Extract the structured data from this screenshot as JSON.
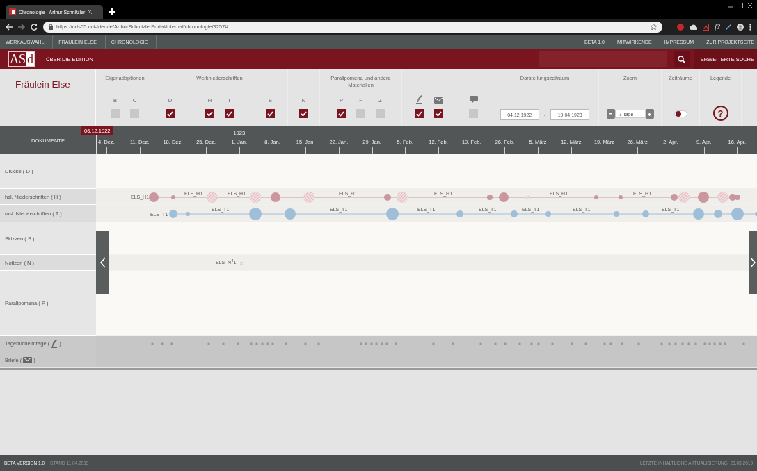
{
  "browser": {
    "tab_title": "Chronologie - Arthur Schnitzler",
    "url": "https://urts55.uni-trier.de/ArthurSchnitzlerPortal/internal/chronologie/9257#",
    "extension_label": "f?"
  },
  "site_nav": {
    "breadcrumbs": [
      "WERKAUSWAHL",
      "FRÄULEIN ELSE",
      "CHRONOLOGIE"
    ],
    "links": [
      "BETA 1.0",
      "MITWIRKENDE",
      "IMPRESSUM",
      "ZUR PROJEKTSEITE"
    ]
  },
  "header": {
    "logo": {
      "main": "AS",
      "accent": "d"
    },
    "menu": [
      "ÜBER DIE EDITION"
    ],
    "advanced_search": "ERWEITERTE SUCHE"
  },
  "filters": {
    "title": "Fräulein Else",
    "groups": [
      {
        "kind": "checks",
        "heading": "Eigenadaptionen",
        "options": [
          {
            "label": "B",
            "checked": false
          },
          {
            "label": "C",
            "checked": false
          }
        ]
      },
      {
        "kind": "checks",
        "options": [
          {
            "label": "D",
            "checked": true
          }
        ]
      },
      {
        "kind": "checks",
        "heading": "Werkniederschriften",
        "options": [
          {
            "label": "H",
            "checked": true
          },
          {
            "label": "T",
            "checked": true
          }
        ]
      },
      {
        "kind": "checks",
        "options": [
          {
            "label": "S",
            "checked": true
          }
        ]
      },
      {
        "kind": "checks",
        "options": [
          {
            "label": "N",
            "checked": true
          }
        ]
      },
      {
        "kind": "checks",
        "heading": "Paralipomena und andere Materialien",
        "options": [
          {
            "label": "P",
            "checked": true
          },
          {
            "label": "F",
            "checked": false
          },
          {
            "label": "Z",
            "checked": false
          }
        ]
      },
      {
        "kind": "checks",
        "options": [
          {
            "kind": "diary",
            "checked": true
          },
          {
            "kind": "correspondence",
            "checked": true
          }
        ]
      },
      {
        "kind": "checks",
        "options": [
          {
            "kind": "comment",
            "checked": false
          }
        ]
      },
      {
        "kind": "daterange",
        "heading": "Darstellungszeitraum",
        "from": "04.12.1922",
        "separator": "-",
        "to": "19.04.1923"
      },
      {
        "kind": "stepper",
        "heading": "Zoom",
        "value": "7 Tage"
      },
      {
        "kind": "toggle",
        "heading": "Zeiträume",
        "on": false
      },
      {
        "kind": "help",
        "heading": "Legende",
        "symbol": "?"
      }
    ]
  },
  "timeline": {
    "column_label": "DOKUMENTE",
    "marker_date": "06.12.1922",
    "year_label": "1923",
    "ticks": [
      "4. Dez.",
      "11. Dez.",
      "18. Dez.",
      "25. Dez.",
      "1. Jan.",
      "8. Jan.",
      "15. Jan.",
      "22. Jan.",
      "29. Jan.",
      "5. Feb.",
      "12. Feb.",
      "19. Feb.",
      "26. Feb.",
      "5. März",
      "12. März",
      "19. März",
      "26. März",
      "2. Apr.",
      "9. Apr.",
      "16. Apr."
    ],
    "rows": [
      {
        "kind": "empty",
        "label": "Drucke ( D )"
      },
      {
        "kind": "manuscript",
        "label": "hsl. Niederschriften ( H )",
        "entry_labels": [
          "ELS_H1",
          "ELS_H1",
          "ELS_H1",
          "ELS_H1",
          "ELS_H1",
          "ELS_H1",
          "ELS_H1"
        ]
      },
      {
        "kind": "typescript",
        "label": "msl. Niederschriften ( T )",
        "entry_labels": [
          "ELS_T1",
          "ELS_T1",
          "ELS_T1",
          "ELS_T1",
          "ELS_T1",
          "ELS_T1",
          "ELS_T1",
          "ELS_T1"
        ]
      },
      {
        "kind": "empty",
        "label": "Skizzen ( S )"
      },
      {
        "kind": "notes",
        "label": "Notizen ( N )",
        "entry_labels": [
          "ELS_N$^{4}$1"
        ]
      },
      {
        "kind": "empty",
        "label": "Paralipomena ( P )"
      },
      {
        "kind": "diary",
        "label_start": "Tagebucheinträge (",
        "label_end": ")"
      },
      {
        "kind": "letters",
        "label_start": "Briefe (",
        "label_end": ")"
      }
    ]
  },
  "footer": {
    "version": "BETA VERSION 1.0",
    "stand": "STAND 11.04.2019",
    "updated": "LETZTE INHALTLICHE AKTUALISIERUNG  28.03.2019"
  }
}
